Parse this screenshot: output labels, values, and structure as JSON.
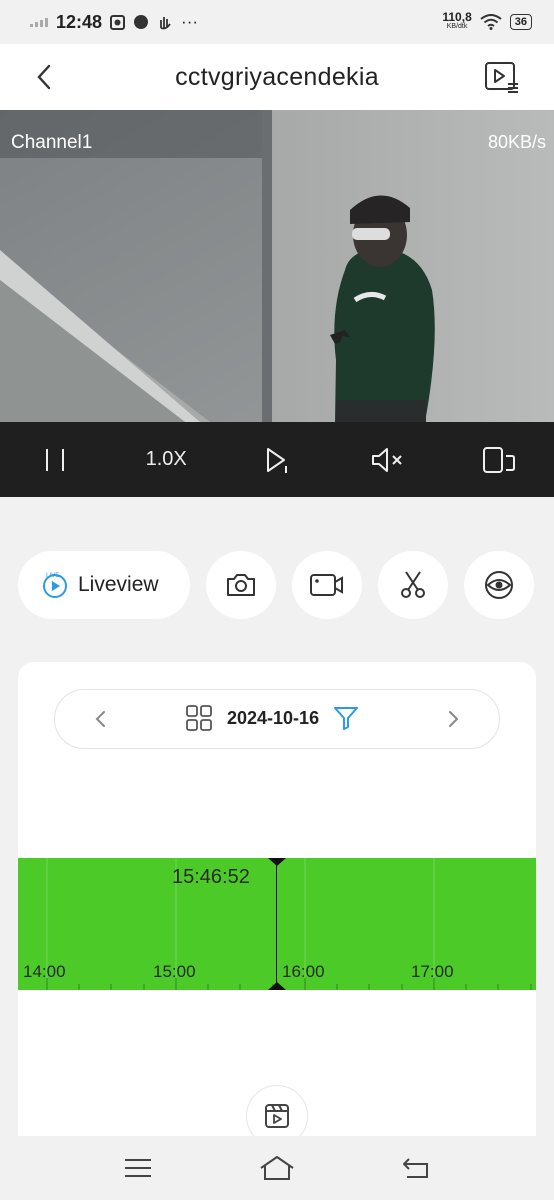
{
  "status_bar": {
    "time": "12:48",
    "extra": "···",
    "net_speed": "110,8",
    "net_unit": "KB/dtk",
    "battery": "36"
  },
  "header": {
    "title": "cctvgriyacendekia",
    "back_icon": "chevron-left-icon",
    "playlist_icon": "playlist-icon"
  },
  "video": {
    "channel": "Channel1",
    "bitrate": "80KB/s"
  },
  "controls": {
    "pause_icon": "pause-icon",
    "speed": "1.0X",
    "next_frame_icon": "play-step-icon",
    "mute_icon": "mute-icon",
    "rotate_icon": "rotate-screen-icon"
  },
  "actions": {
    "liveview_label": "Liveview",
    "buttons": [
      "camera-icon",
      "record-icon",
      "scissors-icon",
      "eye-icon"
    ]
  },
  "date_selector": {
    "date": "2024-10-16"
  },
  "timeline": {
    "current_time": "15:46:52",
    "ticks": [
      "14:00",
      "15:00",
      "16:00",
      "17:00"
    ],
    "color": "#4ccb28"
  }
}
